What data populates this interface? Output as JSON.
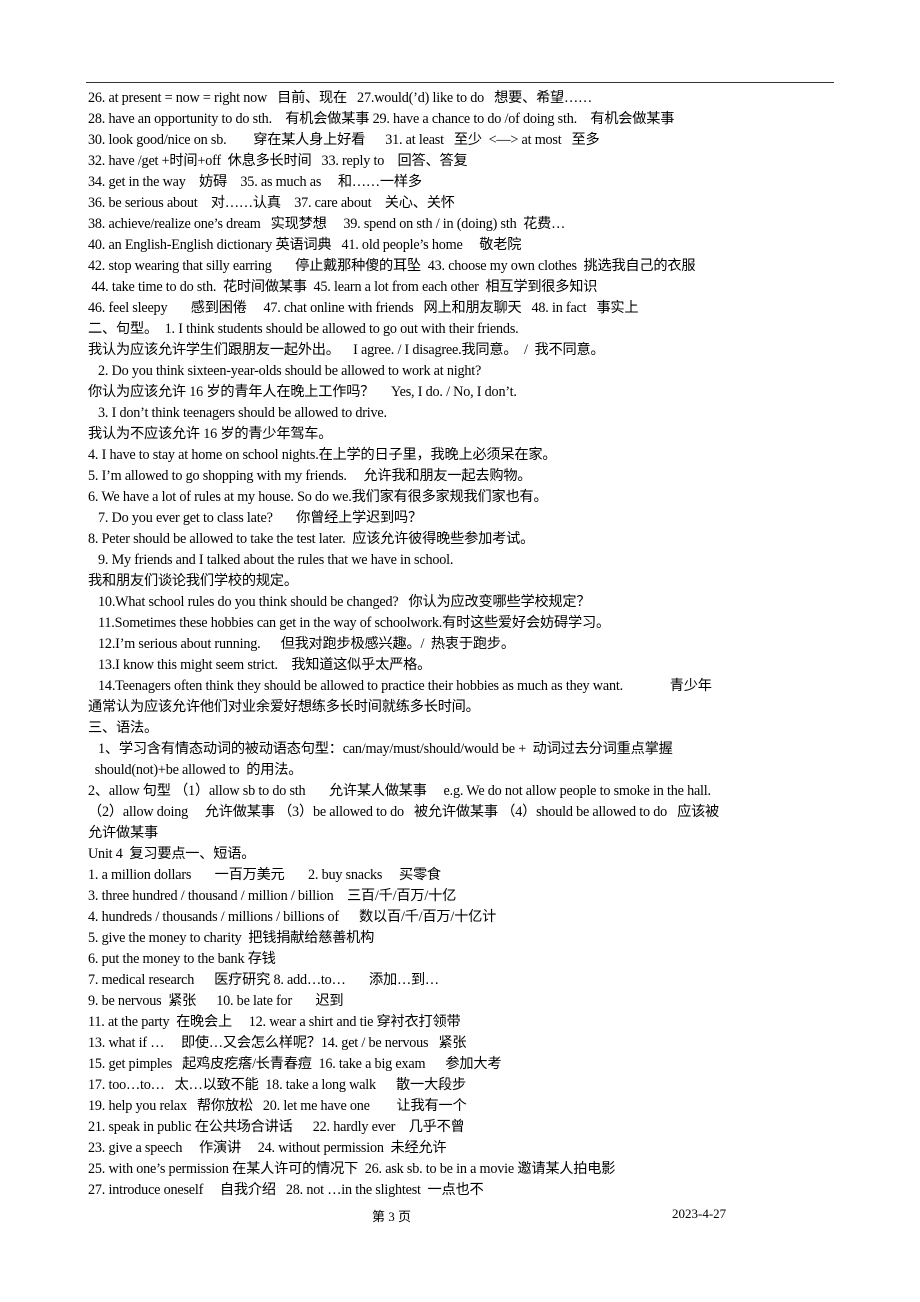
{
  "document": {
    "lines": [
      "26. at present = now = right now   目前、现在   27.would(’d) like to do   想要、希望……",
      "28. have an opportunity to do sth.    有机会做某事 29. have a chance to do /of doing sth.    有机会做某事",
      "30. look good/nice on sb.        穿在某人身上好看      31. at least   至少  <—> at most   至多",
      "32. have /get +时间+off  休息多长时间   33. reply to    回答、答复",
      "34. get in the way    妨碍    35. as much as     和……一样多",
      "36. be serious about    对……认真    37. care about    关心、关怀",
      "38. achieve/realize one’s dream   实现梦想     39. spend on sth / in (doing) sth  花费…",
      "40. an English-English dictionary 英语词典   41. old people’s home     敬老院",
      "42. stop wearing that silly earring       停止戴那种傻的耳坠  43. choose my own clothes  挑选我自己的衣服",
      " 44. take time to do sth.  花时间做某事  45. learn a lot from each other  相互学到很多知识",
      "46. feel sleepy       感到困倦     47. chat online with friends   网上和朋友聊天   48. in fact   事实上",
      "二、句型。  1. I think students should be allowed to go out with their friends.",
      "我认为应该允许学生们跟朋友一起外出。    I agree. / I disagree.我同意。  /  我不同意。",
      "   2. Do you think sixteen-year-olds should be allowed to work at night?",
      "你认为应该允许 16 岁的青年人在晚上工作吗？     Yes, I do. / No, I don’t.",
      "   3. I don’t think teenagers should be allowed to drive.",
      "我认为不应该允许 16 岁的青少年驾车。",
      "4. I have to stay at home on school nights.在上学的日子里，我晚上必须呆在家。",
      "5. I’m allowed to go shopping with my friends.     允许我和朋友一起去购物。",
      "6. We have a lot of rules at my house. So do we.我们家有很多家规我们家也有。",
      "   7. Do you ever get to class late?       你曾经上学迟到吗？",
      "8. Peter should be allowed to take the test later.  应该允许彼得晚些参加考试。",
      "   9. My friends and I talked about the rules that we have in school.",
      "我和朋友们谈论我们学校的规定。",
      "   10.What school rules do you think should be changed?   你认为应改变哪些学校规定？",
      "   11.Sometimes these hobbies can get in the way of schoolwork.有时这些爱好会妨碍学习。",
      "   12.I’m serious about running.      但我对跑步极感兴趣。/  热衷于跑步。",
      "   13.I know this might seem strict.    我知道这似乎太严格。",
      "   14.Teenagers often think they should be allowed to practice their hobbies as much as they want.              青少年",
      "通常认为应该允许他们对业余爱好想练多长时间就练多长时间。",
      "三、语法。",
      "   1、学习含有情态动词的被动语态句型：can/may/must/should/would be +  动词过去分词重点掌握",
      "  should(not)+be allowed to  的用法。",
      "2、allow 句型 （1）allow sb to do sth       允许某人做某事     e.g. We do not allow people to smoke in the hall.",
      "（2）allow doing     允许做某事 （3）be allowed to do   被允许做某事 （4）should be allowed to do   应该被",
      "允许做某事",
      "Unit 4  复习要点一、短语。",
      "1. a million dollars       一百万美元       2. buy snacks     买零食",
      "3. three hundred / thousand / million / billion    三百/千/百万/十亿",
      "4. hundreds / thousands / millions / billions of      数以百/千/百万/十亿计",
      "5. give the money to charity  把钱捐献给慈善机构",
      "6. put the money to the bank 存钱",
      "7. medical research      医疗研究 8. add…to…       添加…到…",
      "9. be nervous  紧张      10. be late for       迟到",
      "11. at the party  在晚会上     12. wear a shirt and tie 穿衬衣打领带",
      "13. what if …     即使…又会怎么样呢？14. get / be nervous   紧张",
      "15. get pimples   起鸡皮疙瘩/长青春痘  16. take a big exam      参加大考",
      "17. too…to…   太…以致不能  18. take a long walk      散一大段步",
      "19. help you relax   帮你放松   20. let me have one        让我有一个",
      "21. speak in public 在公共场合讲话      22. hardly ever    几乎不曾",
      "23. give a speech     作演讲     24. without permission  未经允许",
      "25. with one’s permission 在某人许可的情况下  26. ask sb. to be in a movie 邀请某人拍电影",
      "27. introduce oneself     自我介绍   28. not …in the slightest  一点也不"
    ]
  },
  "footer": {
    "page": "第 3 页",
    "date": "2023-4-27"
  }
}
